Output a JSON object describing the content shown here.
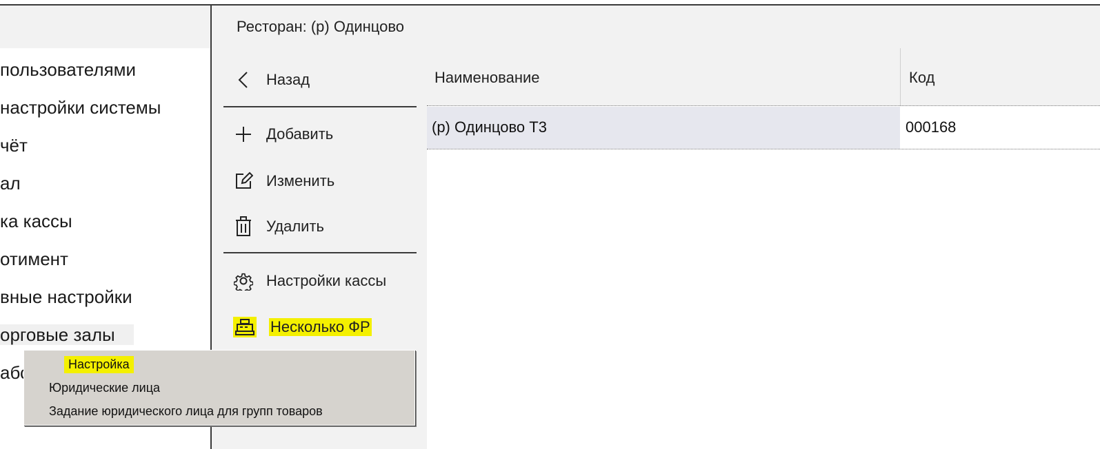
{
  "left_menu": {
    "items": [
      {
        "label": "пользователями"
      },
      {
        "label": "настройки системы"
      },
      {
        "label": "чёт"
      },
      {
        "label": "ал"
      },
      {
        "label": "ка кассы"
      },
      {
        "label": "отимент"
      },
      {
        "label": "вные настройки"
      },
      {
        "label": "орговые залы"
      },
      {
        "label": "абс"
      }
    ]
  },
  "header": {
    "title": "Ресторан: (р) Одинцово"
  },
  "actions": {
    "back": "Назад",
    "add": "Добавить",
    "edit": "Изменить",
    "delete": "Удалить",
    "cash_settings": "Настройки кассы",
    "multi_fr": "Несколько ФР"
  },
  "table": {
    "columns": [
      "Наименование",
      "Код"
    ],
    "rows": [
      {
        "name": "(р) Одинцово Т3",
        "code": "000168"
      }
    ]
  },
  "context_menu": {
    "items": [
      {
        "label": "Настройка"
      },
      {
        "label": "Юридические лица"
      },
      {
        "label": "Задание юридического лица для групп товаров"
      }
    ]
  },
  "colors": {
    "highlight": "#f4f000",
    "selected_row": "#e6e7ee",
    "panel": "#f2f2f2"
  }
}
